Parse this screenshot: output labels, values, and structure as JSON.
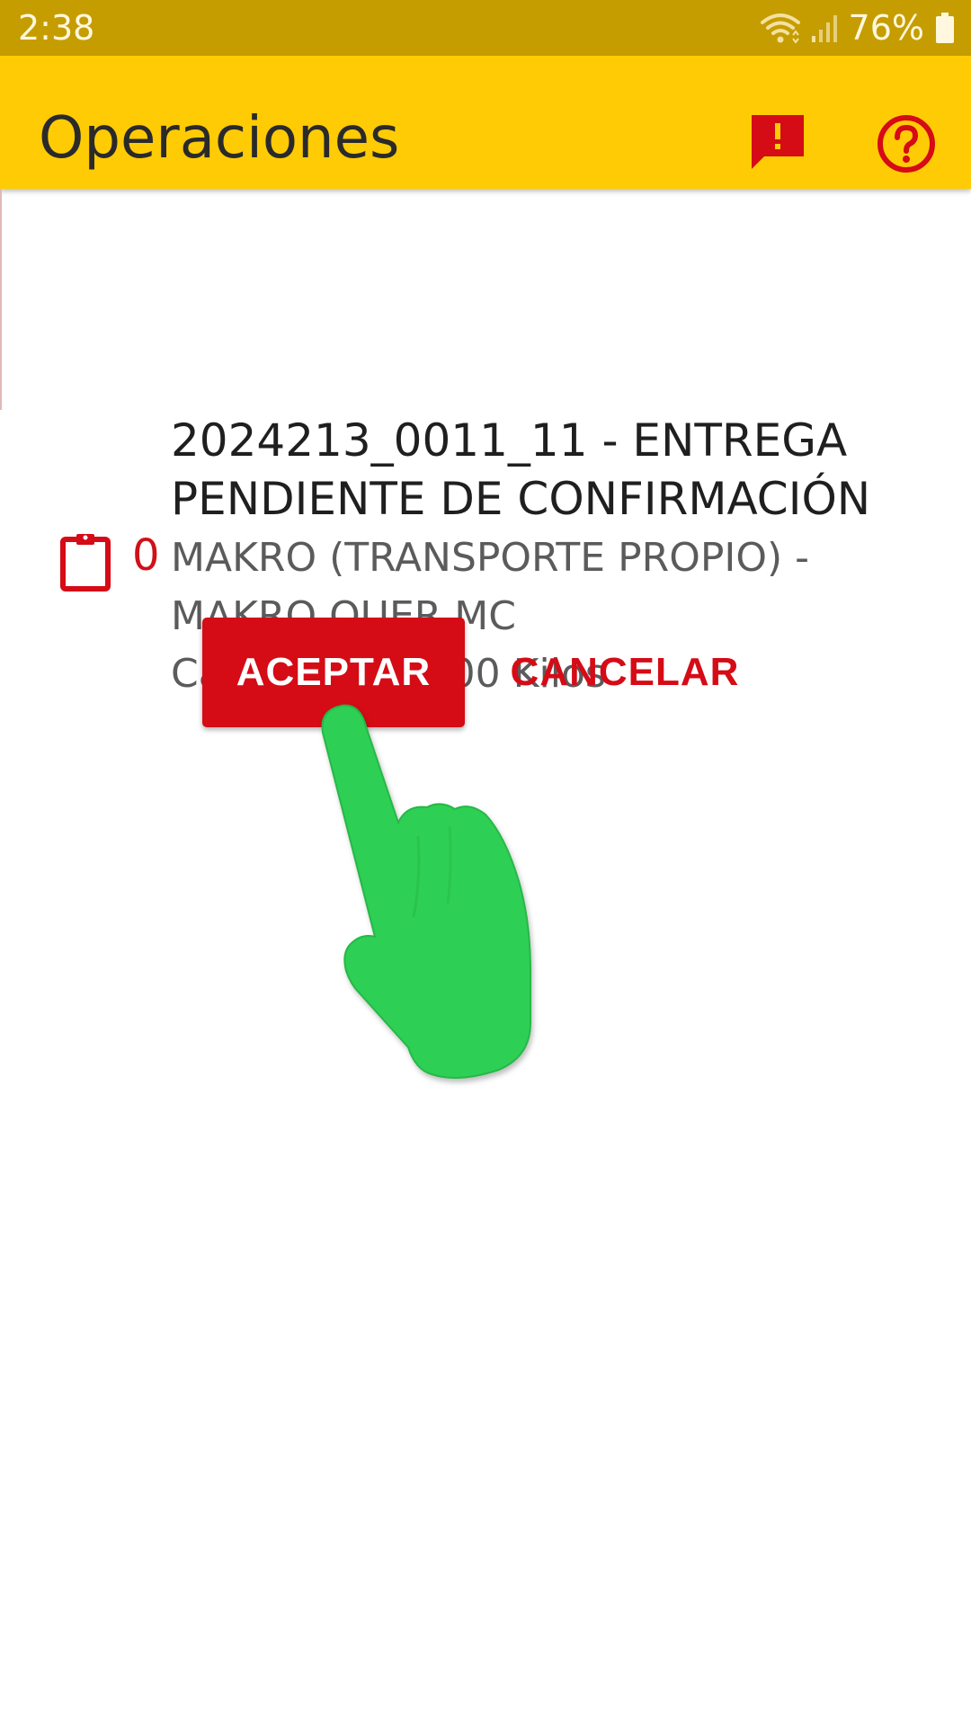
{
  "status_bar": {
    "time": "2:38",
    "battery": "76%",
    "icons": [
      "wifi-icon",
      "signal-icon",
      "battery-icon"
    ]
  },
  "app_bar": {
    "title": "Operaciones",
    "actions": [
      "alert-icon",
      "help-icon"
    ],
    "background_color": "#ffcb05"
  },
  "operation": {
    "count": "0",
    "title": "2024213_0011_11 - ENTREGA PENDIENTE DE CONFIRMACIÓN",
    "subtitle": "MAKRO (TRANSPORTE PROPIO) - MAKRO QUER MC",
    "quantity": "Cantidad: 18000 Kilos",
    "icon": "clipboard-icon"
  },
  "dialog": {
    "accept_label": "ACEPTAR",
    "cancel_label": "CANCELAR"
  },
  "colors": {
    "accent": "#d50b16",
    "status_bar": "#c69d00",
    "pointer_hand": "#2fcf55"
  },
  "overlay": {
    "icon": "pointing-hand-icon"
  }
}
